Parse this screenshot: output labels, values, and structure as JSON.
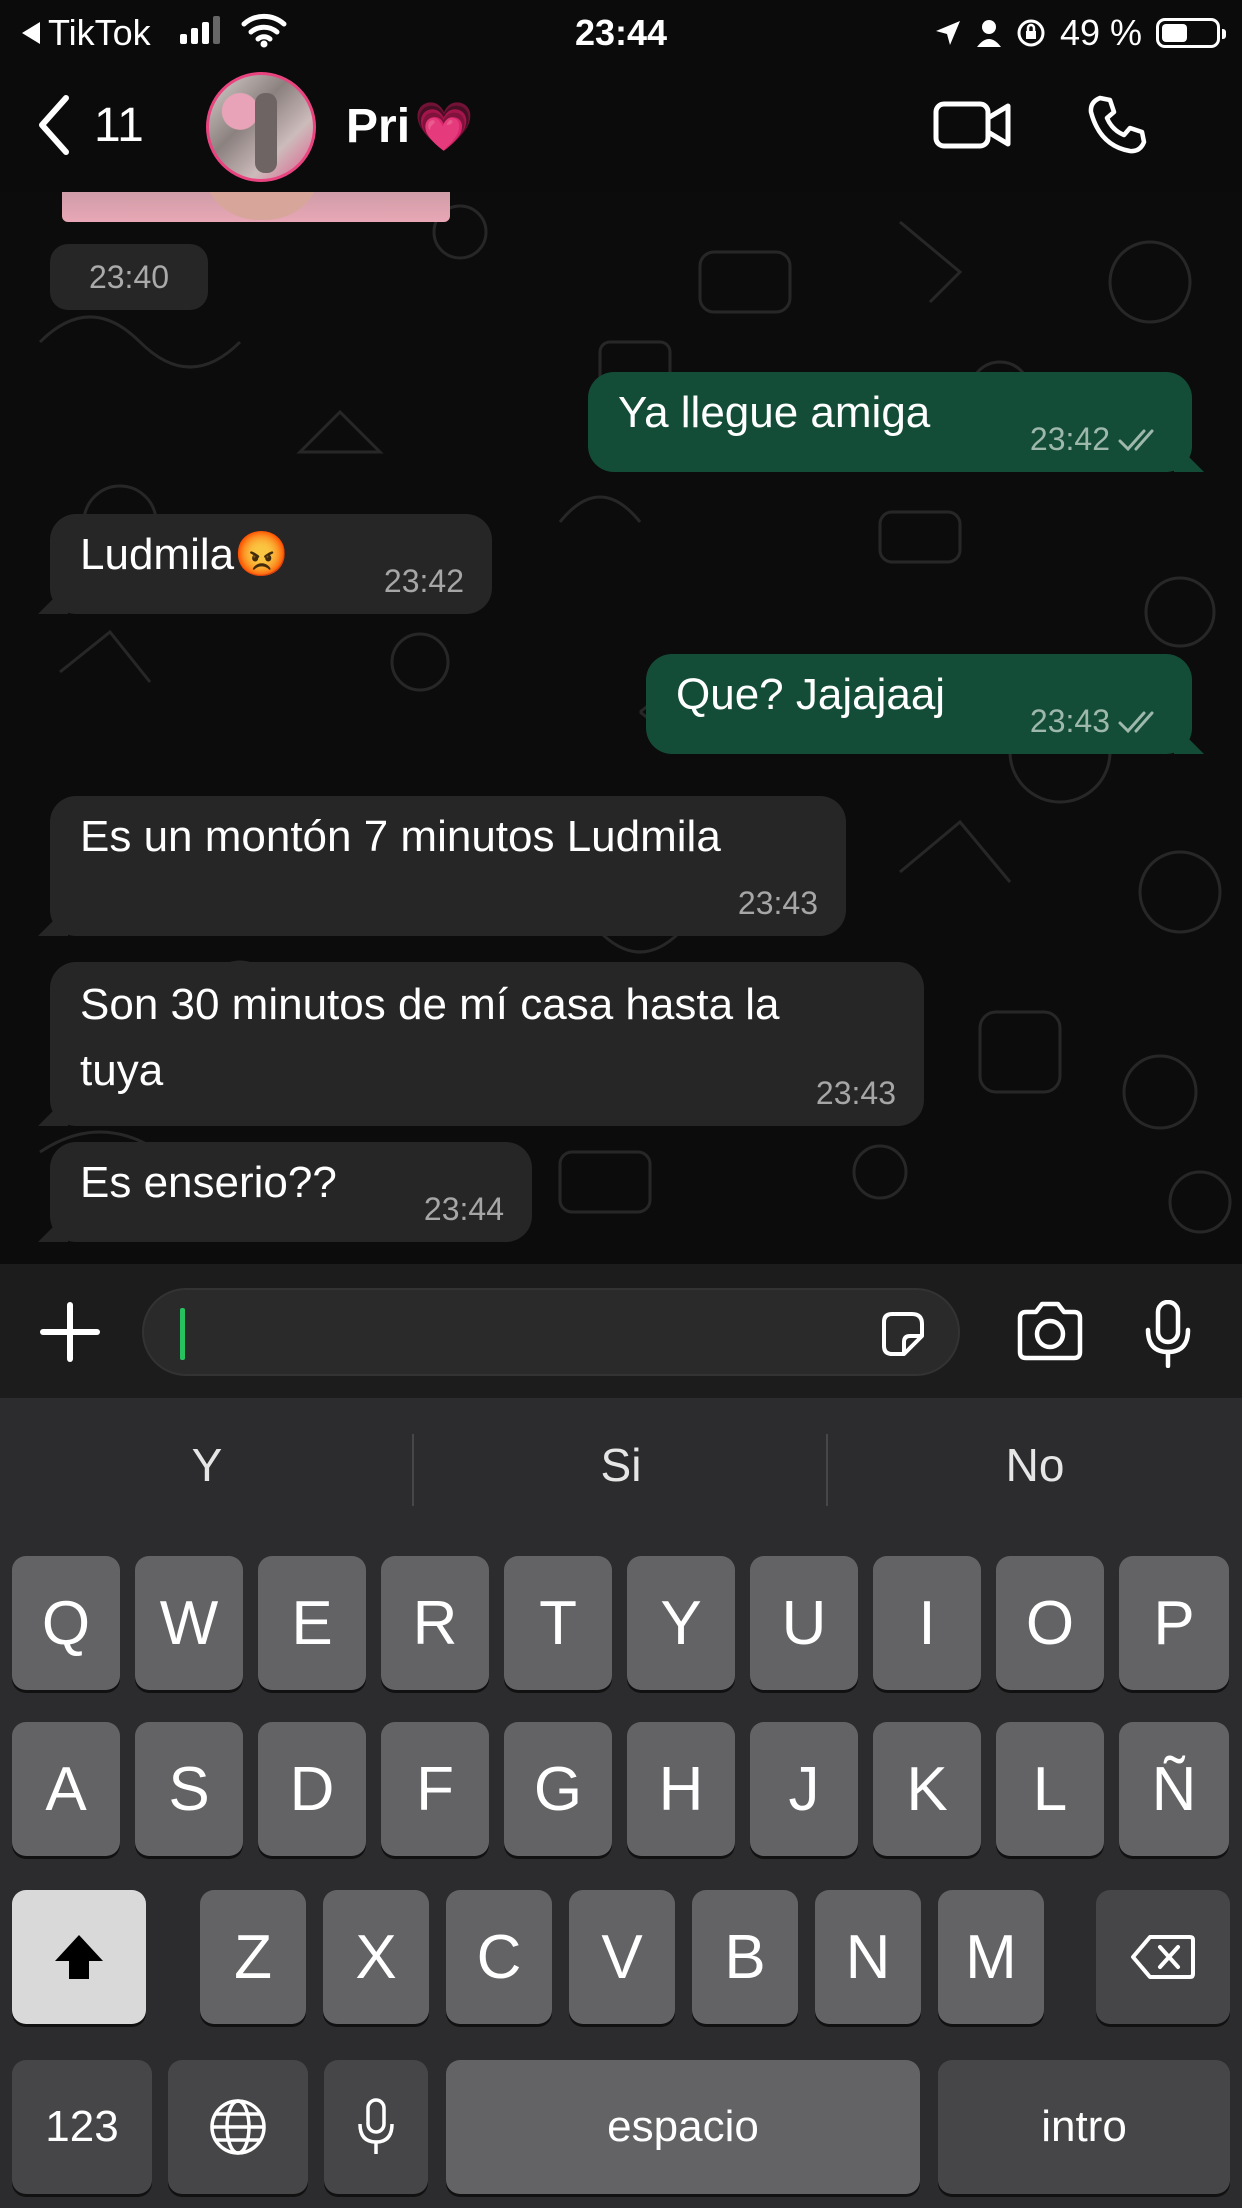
{
  "status_bar": {
    "back_app": "TikTok",
    "time": "23:44",
    "battery": "49 %",
    "battery_level": 0.49
  },
  "header": {
    "back_count": "11",
    "contact_name": "Pri",
    "contact_emoji": "💗",
    "icons": [
      "chevron-left-icon",
      "video-call-icon",
      "phone-icon"
    ]
  },
  "chat": {
    "image_time": "23:40",
    "messages": [
      {
        "direction": "out",
        "text": "Ya llegue amiga",
        "time": "23:42",
        "status": "read"
      },
      {
        "direction": "in",
        "text": "Ludmila",
        "emoji": "😡",
        "time": "23:42"
      },
      {
        "direction": "out",
        "text": "Que? Jajajaaj",
        "time": "23:43",
        "status": "read"
      },
      {
        "direction": "in",
        "text": "Es un montón 7 minutos Ludmila",
        "time": "23:43"
      },
      {
        "direction": "in",
        "text": "Son 30 minutos de mí casa hasta la tuya",
        "lines": [
          "Son 30 minutos de mí casa hasta la",
          "tuya"
        ],
        "time": "23:43"
      },
      {
        "direction": "in",
        "text": "Es enserio??",
        "time": "23:44"
      }
    ]
  },
  "input": {
    "value": "",
    "icons": [
      "plus-icon",
      "sticker-icon",
      "camera-icon",
      "microphone-icon"
    ]
  },
  "keyboard": {
    "suggestions": [
      "Y",
      "Si",
      "No"
    ],
    "row1": [
      "Q",
      "W",
      "E",
      "R",
      "T",
      "Y",
      "U",
      "I",
      "O",
      "P"
    ],
    "row2": [
      "A",
      "S",
      "D",
      "F",
      "G",
      "H",
      "J",
      "K",
      "L",
      "Ñ"
    ],
    "row3": [
      "Z",
      "X",
      "C",
      "V",
      "B",
      "N",
      "M"
    ],
    "numbers_label": "123",
    "space_label": "espacio",
    "return_label": "intro"
  }
}
